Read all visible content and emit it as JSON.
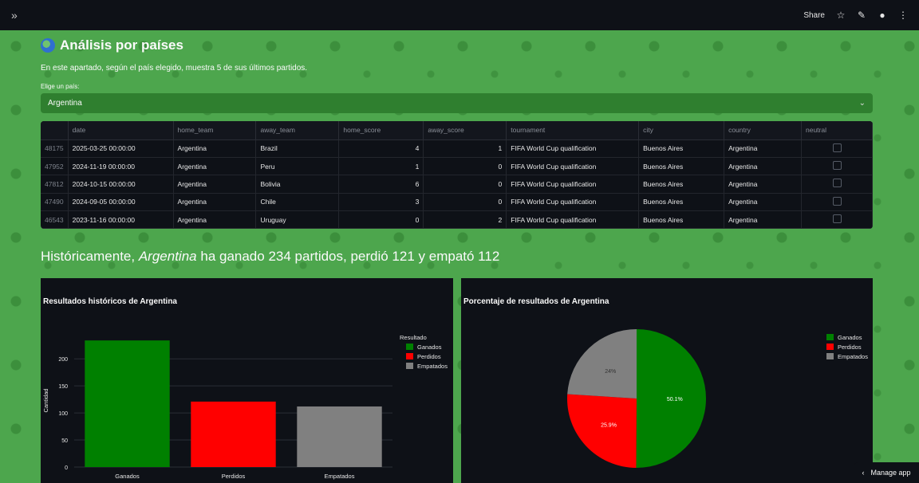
{
  "topbar": {
    "expand_icon": "»",
    "share_label": "Share",
    "star_icon": "☆",
    "edit_icon": "✎",
    "github_icon": "●",
    "menu_icon": "⋮"
  },
  "header": {
    "title": "Análisis por países",
    "description": "En este apartado, según el país elegido, muestra 5 de sus últimos partidos."
  },
  "select": {
    "label": "Elige un país:",
    "value": "Argentina"
  },
  "table": {
    "columns": [
      "",
      "date",
      "home_team",
      "away_team",
      "home_score",
      "away_score",
      "tournament",
      "city",
      "country",
      "neutral"
    ],
    "rows": [
      [
        "48175",
        "2025-03-25 00:00:00",
        "Argentina",
        "Brazil",
        "4",
        "1",
        "FIFA World Cup qualification",
        "Buenos Aires",
        "Argentina"
      ],
      [
        "47952",
        "2024-11-19 00:00:00",
        "Argentina",
        "Peru",
        "1",
        "0",
        "FIFA World Cup qualification",
        "Buenos Aires",
        "Argentina"
      ],
      [
        "47812",
        "2024-10-15 00:00:00",
        "Argentina",
        "Bolivia",
        "6",
        "0",
        "FIFA World Cup qualification",
        "Buenos Aires",
        "Argentina"
      ],
      [
        "47490",
        "2024-09-05 00:00:00",
        "Argentina",
        "Chile",
        "3",
        "0",
        "FIFA World Cup qualification",
        "Buenos Aires",
        "Argentina"
      ],
      [
        "46543",
        "2023-11-16 00:00:00",
        "Argentina",
        "Uruguay",
        "0",
        "2",
        "FIFA World Cup qualification",
        "Buenos Aires",
        "Argentina"
      ]
    ]
  },
  "history": {
    "prefix": "Históricamente,",
    "country": "Argentina",
    "suffix": "ha ganado 234 partidos, perdió 121 y empató 112"
  },
  "chart_data": [
    {
      "type": "bar",
      "title": "Resultados históricos de Argentina",
      "categories": [
        "Ganados",
        "Perdidos",
        "Empatados"
      ],
      "values": [
        234,
        121,
        112
      ],
      "colors": [
        "#008000",
        "#ff0000",
        "#808080"
      ],
      "ylabel": "Cantidad",
      "xlabel": "",
      "yticks": [
        0,
        50,
        100,
        150,
        200
      ],
      "ylim": [
        0,
        246
      ],
      "legend_title": "Resultado",
      "legend_position": "top-right",
      "grid": true
    },
    {
      "type": "pie",
      "title": "Porcentaje de resultados de Argentina",
      "labels": [
        "Ganados",
        "Perdidos",
        "Empatados"
      ],
      "values": [
        50.1,
        25.9,
        24.0
      ],
      "value_labels": [
        "50.1%",
        "25.9%",
        "24%"
      ],
      "colors": [
        "#008000",
        "#ff0000",
        "#808080"
      ],
      "legend_position": "top-right"
    }
  ],
  "footer": {
    "manage_label": "Manage app",
    "chevron_icon": "‹"
  }
}
